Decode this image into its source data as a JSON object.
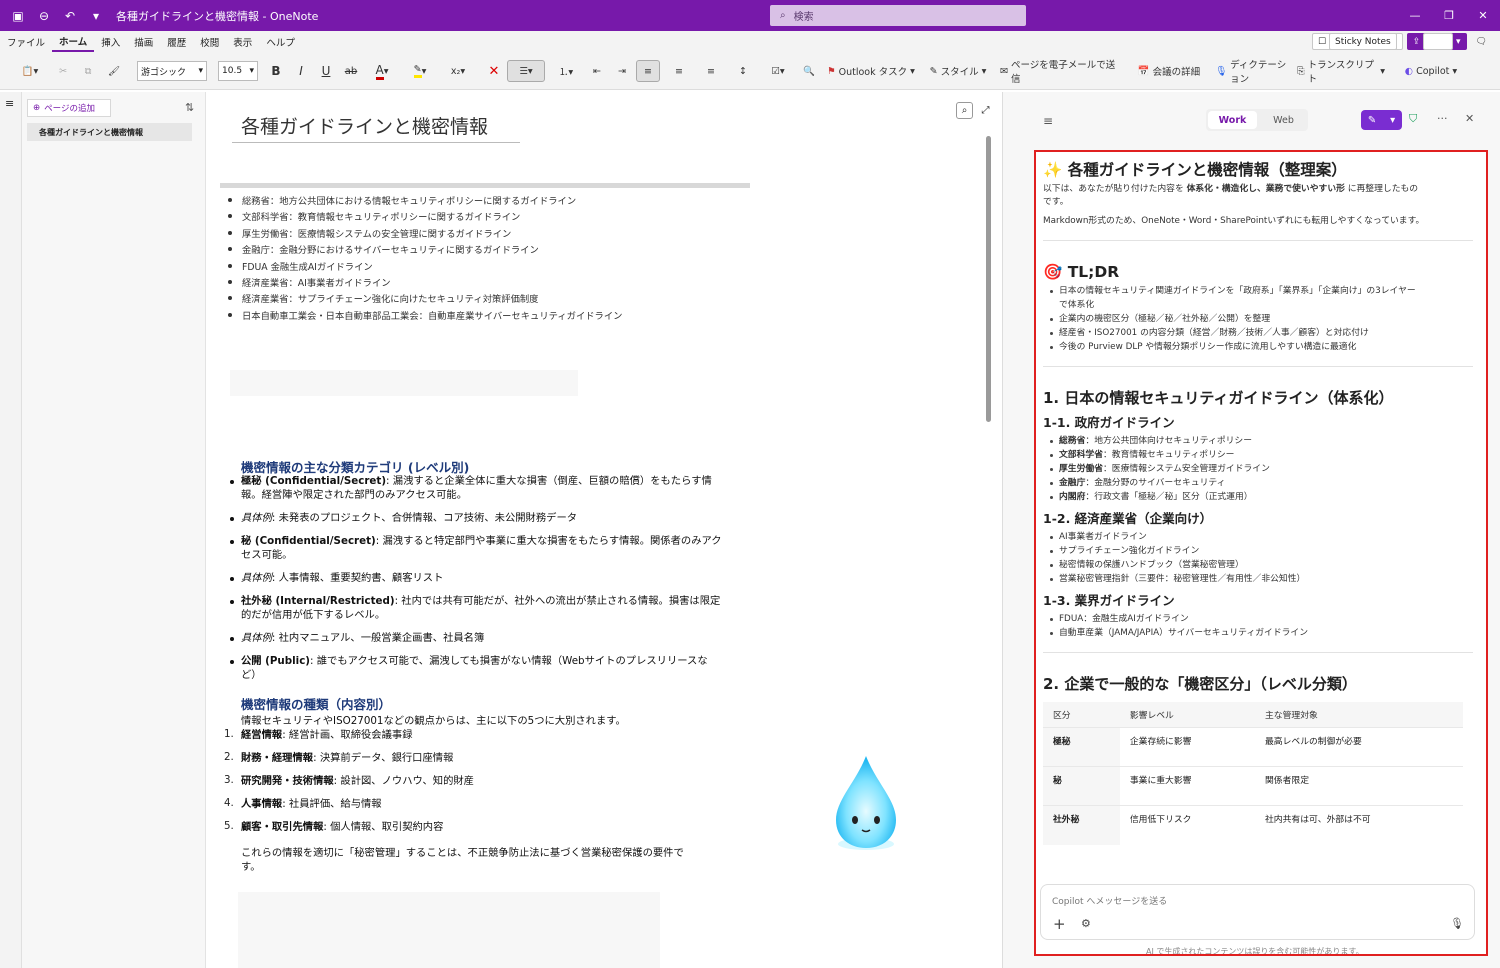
{
  "window": {
    "title": "各種ガイドラインと機密情報",
    "app": "OneNote",
    "search_placeholder": "検索"
  },
  "menu": {
    "items": [
      "ファイル",
      "ホーム",
      "挿入",
      "描画",
      "履歴",
      "校閲",
      "表示",
      "ヘルプ"
    ],
    "sticky": "Sticky Notes",
    "share": "共有"
  },
  "ribbon": {
    "font": "游ゴシック",
    "size": "10.5",
    "outlook": "Outlook タスク",
    "style": "スタイル",
    "email": "ページを電子メールで送信",
    "meeting": "会議の詳細",
    "dictation": "ディクテーション",
    "transcript": "トランスクリプト",
    "copilot": "Copilot"
  },
  "pages": {
    "add": "ページの追加",
    "items": [
      "各種ガイドラインと機密情報"
    ]
  },
  "note": {
    "title": "各種ガイドラインと機密情報",
    "bullets": [
      "総務省：地方公共団体における情報セキュリティポリシーに関するガイドライン",
      "文部科学省：教育情報セキュリティポリシーに関するガイドライン",
      "厚生労働省：医療情報システムの安全管理に関するガイドライン",
      "金融庁：金融分野におけるサイバーセキュリティに関するガイドライン",
      "FDUA 金融生成AIガイドライン",
      "経済産業省：AI事業者ガイドライン",
      "経済産業省：サプライチェーン強化に向けたセキュリティ対策評価制度",
      "日本自動車工業会・日本自動車部品工業会：自動車産業サイバーセキュリティガイドライン"
    ],
    "sec1": "機密情報の主な分類カテゴリ (レベル別)",
    "c1_b": "極秘 (Confidential/Secret)",
    "c1_t": ": 漏洩すると企業全体に重大な損害（倒産、巨額の賠償）をもたらす情",
    "c1_t2": "報。経営陣や限定された部門のみアクセス可能。",
    "ex_label": "具体例",
    "ex1": ": 未発表のプロジェクト、合併情報、コア技術、未公開財務データ",
    "c2_b": "秘 (Confidential/Secret)",
    "c2_t": ": 漏洩すると特定部門や事業に重大な損害をもたらす情報。関係者のみアク",
    "c2_t2": "セス可能。",
    "ex2": ": 人事情報、重要契約書、顧客リスト",
    "c3_b": "社外秘 (Internal/Restricted)",
    "c3_t": ": 社内では共有可能だが、社外への流出が禁止される情報。損害は限定",
    "c3_t2": "的だが信用が低下するレベル。",
    "ex3": ": 社内マニュアル、一般営業企画書、社員名簿",
    "c4_b": "公開 (Public)",
    "c4_t": ": 誰でもアクセス可能で、漏洩しても損害がない情報（Webサイトのプレスリリースな",
    "c4_t2": "ど）",
    "sec2": "機密情報の種類（内容別）",
    "intro": "情報セキュリティやISO27001などの観点からは、主に以下の5つに大別されます。",
    "types": [
      {
        "n": "1.",
        "b": "経営情報",
        "t": ": 経営計画、取締役会議事録"
      },
      {
        "n": "2.",
        "b": "財務・経理情報",
        "t": ": 決算前データ、銀行口座情報"
      },
      {
        "n": "3.",
        "b": "研究開発・技術情報",
        "t": ": 設計図、ノウハウ、知的財産"
      },
      {
        "n": "4.",
        "b": "人事情報",
        "t": ": 社員評価、給与情報"
      },
      {
        "n": "5.",
        "b": "顧客・取引先情報",
        "t": ": 個人情報、取引契約内容"
      }
    ],
    "closing1": "これらの情報を適切に「秘密管理」することは、不正競争防止法に基づく営業秘密保護の要件で",
    "closing2": "す。"
  },
  "copilot": {
    "tab_work": "Work",
    "tab_web": "Web",
    "h1": "✨ 各種ガイドラインと機密情報（整理案）",
    "intro1a": "以下は、あなたが貼り付けた内容を ",
    "intro1b": "体系化・構造化し、業務で使いやすい形",
    "intro1c": " に再整理したもの",
    "intro1d": "です。",
    "intro2": "Markdown形式のため、OneNote・Word・SharePointいずれにも転用しやすくなっています。",
    "tldr": "🎯 TL;DR",
    "tldr_items": [
      "日本の情報セキュリティ関連ガイドラインを「政府系」「業界系」「企業向け」の3レイヤー",
      "で体系化",
      "企業内の機密区分（極秘／秘／社外秘／公開）を整理",
      "経産省・ISO27001 の内容分類（経営／財務／技術／人事／顧客）と対応付け",
      "今後の Purview DLP や情報分類ポリシー作成に流用しやすい構造に最適化"
    ],
    "s1": "1. 日本の情報セキュリティガイドライン（体系化）",
    "s1_1": "1-1. 政府ガイドライン",
    "gov": [
      {
        "b": "総務省",
        "t": "：地方公共団体向けセキュリティポリシー"
      },
      {
        "b": "文部科学省",
        "t": "：教育情報セキュリティポリシー"
      },
      {
        "b": "厚生労働省",
        "t": "：医療情報システム安全管理ガイドライン"
      },
      {
        "b": "金融庁",
        "t": "：金融分野のサイバーセキュリティ"
      },
      {
        "b": "内閣府",
        "t": "：行政文書「極秘／秘」区分（正式運用）"
      }
    ],
    "s1_2": "1-2. 経済産業省（企業向け）",
    "meti": [
      "AI事業者ガイドライン",
      "サプライチェーン強化ガイドライン",
      "秘密情報の保護ハンドブック（営業秘密管理）",
      "営業秘密管理指針（三要件：秘密管理性／有用性／非公知性）"
    ],
    "s1_3": "1-3. 業界ガイドライン",
    "ind": [
      "FDUA：金融生成AIガイドライン",
      "自動車産業（JAMA/JAPIA）サイバーセキュリティガイドライン"
    ],
    "s2": "2. 企業で一般的な「機密区分」（レベル分類）",
    "table": {
      "headers": [
        "区分",
        "影響レベル",
        "主な管理対象"
      ],
      "rows": [
        [
          "極秘",
          "企業存続に影響",
          "最高レベルの制御が必要"
        ],
        [
          "秘",
          "事業に重大影響",
          "関係者限定"
        ],
        [
          "社外秘",
          "信用低下リスク",
          "社内共有は可、外部は不可"
        ]
      ]
    },
    "composer_placeholder": "Copilot へメッセージを送る",
    "disclaimer": "AI で生成されたコンテンツは誤りを含む可能性があります。"
  }
}
